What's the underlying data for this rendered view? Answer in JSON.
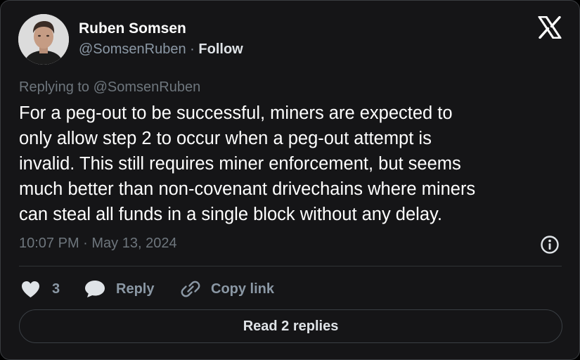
{
  "author": {
    "name": "Ruben Somsen",
    "handle": "@SomsenRuben",
    "separator": "·",
    "follow_label": "Follow"
  },
  "icons": {
    "logo": "x-logo-icon",
    "info": "info-icon",
    "like": "heart-icon",
    "reply": "speech-bubble-icon",
    "copy": "link-icon"
  },
  "reply_context": {
    "prefix": "Replying to",
    "handle": "@SomsenRuben"
  },
  "tweet": {
    "lines": [
      "For a peg-out to be successful, miners are expected to",
      "only allow step 2 to occur when a peg-out attempt is",
      "invalid. This still requires miner enforcement, but seems",
      "much better than non-covenant drivechains where miners",
      "can steal all funds in a single block without any delay."
    ]
  },
  "timestamp": "10:07 PM · May 13, 2024",
  "actions": {
    "like_count": "3",
    "reply_label": "Reply",
    "copy_label": "Copy link"
  },
  "read_replies_label": "Read 2 replies",
  "colors": {
    "card_background": "#151517",
    "text_primary": "#ffffff",
    "text_secondary": "#6e767d",
    "border": "#3a3d41"
  }
}
